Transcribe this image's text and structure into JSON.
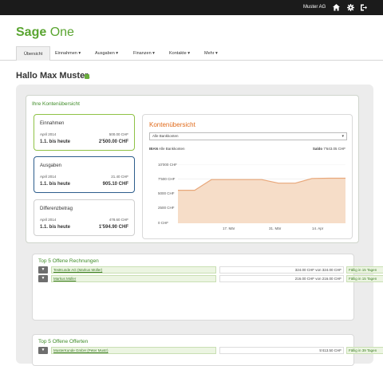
{
  "topbar": {
    "user": "Muster AG",
    "icons": [
      "home-icon",
      "gear-icon",
      "logout-icon"
    ]
  },
  "logo": {
    "part1": "Sage",
    "part2": " One"
  },
  "nav": {
    "items": [
      {
        "label": "Übersicht"
      },
      {
        "label": "Einnahmen ▾"
      },
      {
        "label": "Ausgaben ▾"
      },
      {
        "label": "Finanzen ▾"
      },
      {
        "label": "Kontakte ▾"
      },
      {
        "label": "Mehr ▾"
      }
    ]
  },
  "greeting": "Hallo Max Muster.",
  "overview": {
    "title": "Ihre Kontenübersicht",
    "cards": [
      {
        "title": "Einnahmen",
        "period": "April 2014",
        "period_value": "500.00 CHF",
        "total_label": "1.1. bis heute",
        "total_value": "2'500.00 CHF",
        "border_color": "#8fc246"
      },
      {
        "title": "Ausgaben",
        "period": "April 2014",
        "period_value": "21.40 CHF",
        "total_label": "1.1. bis heute",
        "total_value": "905.10 CHF",
        "border_color": "#2d5d8c"
      },
      {
        "title": "Differenzbetrag",
        "period": "April 2014",
        "period_value": "478.60 CHF",
        "total_label": "1.1. bis heute",
        "total_value": "1'594.90 CHF",
        "border_color": "#cfcfcf"
      }
    ]
  },
  "konten": {
    "title": "Kontenübersicht",
    "select_value": "Alle Bankkonten",
    "iban_label": "IBAN",
    "iban_value": "Alle Bankkonten",
    "saldo_label": "Saldo",
    "saldo_value": "7'643.05 CHF"
  },
  "chart_data": {
    "type": "area",
    "x": [
      "",
      "17. Mär",
      "31. Mär",
      "14. Apr"
    ],
    "ytick_labels": [
      "10'000 CHF",
      "7'500 CHF",
      "5000 CHF",
      "2500 CHF",
      "0 CHF"
    ],
    "ylim": [
      0,
      10000
    ],
    "series": [
      {
        "values": [
          5600,
          5600,
          7400,
          7400,
          7400,
          7400,
          6800,
          6800,
          7600,
          7640,
          7640
        ]
      }
    ],
    "color": "#e8a77a",
    "grid": true
  },
  "rechnungen": {
    "title": "Top 5 Offene Rechnungen",
    "rows": [
      {
        "name": "TestKunde AG (Markus Müller)",
        "amount": "324.00 CHF von 324.00 CHF",
        "due": "Fällig in 15 Tagen"
      },
      {
        "name": "Markus Müller",
        "amount": "216.00 CHF von 216.00 CHF",
        "due": "Fällig in 15 Tagen"
      }
    ]
  },
  "offerten": {
    "title": "Top 5 Offene Offerten",
    "rows": [
      {
        "name": "MusterKunde GmbH (Peter Mustr)",
        "amount": "5'413.50 CHF",
        "due": "Fällig in 39 Tagen"
      }
    ]
  }
}
